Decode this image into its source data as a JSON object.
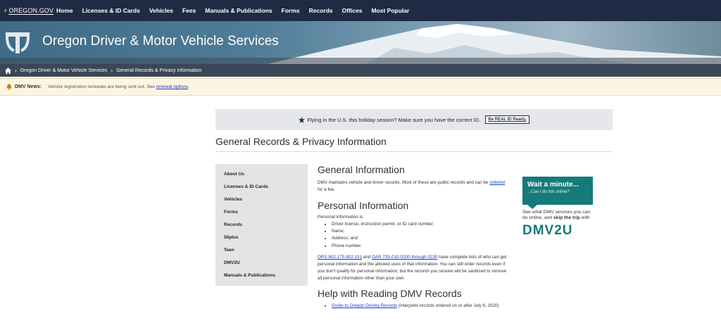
{
  "topnav": {
    "logo_text": "OREGON.GOV",
    "links": [
      "Home",
      "Licenses & ID Cards",
      "Vehicles",
      "Fees",
      "Manuals & Publications",
      "Forms",
      "Records",
      "Offices",
      "Most Popular"
    ]
  },
  "hero": {
    "title": "Oregon Driver & Motor Vehicle Services"
  },
  "breadcrumb": {
    "items": [
      "Oregon Driver & Motor Vehicle Services",
      "General Records & Privacy Information"
    ]
  },
  "news": {
    "label": "DMV News:",
    "text": "Vehicle registration renewals are being sent out. See",
    "link": "renewal options",
    "end": "."
  },
  "realid": {
    "text": "Flying in the U.S. this holiday season? Make sure you have the correct ID.",
    "button": "Be REAL ID Ready."
  },
  "page_title": "General Records & Privacy Information",
  "sidebar": {
    "items": [
      "About Us",
      "Licenses & ID Cards",
      "Vehicles",
      "Forms",
      "Records",
      "50plus",
      "Teen",
      "DMV2U",
      "Manuals & Publications"
    ]
  },
  "main": {
    "general": {
      "heading": "General Information",
      "text": "DMV maintains vehicle and driver records. Most of these are public records and can be",
      "link": "ordered",
      "text_end": "for a fee."
    },
    "personal": {
      "heading": "Personal Information",
      "intro": "Personal information is:",
      "items": [
        "Driver license, instruction permit, or ID card number;",
        "Name;",
        "Address; and",
        "Phone number."
      ],
      "link1": "ORS 802.175-802.191",
      "and": "and",
      "link2": "OAR 735-010-0200 through 0230",
      "para": "have complete lists of who can get personal information and the allowed uses of that information. You can still order records even if you don't qualify for personal information, but the records you receive will be sanitized to remove all personal information other than your own."
    },
    "help": {
      "heading": "Help with Reading DMV Records",
      "link": "Guide to Oregon Driving Records",
      "text": "(interprets records ordered on or after July 6, 2020)"
    }
  },
  "promo": {
    "heading": "Wait a minute...",
    "sub": "...Can I do this online?",
    "body1": "See what DMV services you can do online, and",
    "body_bold": "skip the trip",
    "body2": "with",
    "brand": "DMV2U"
  },
  "colors": {
    "nav": "#1f2a44",
    "breadcrumb": "#3b4656",
    "news_bg": "#fcf5e2",
    "accent": "#157a7a",
    "link": "#1a3dbd"
  }
}
